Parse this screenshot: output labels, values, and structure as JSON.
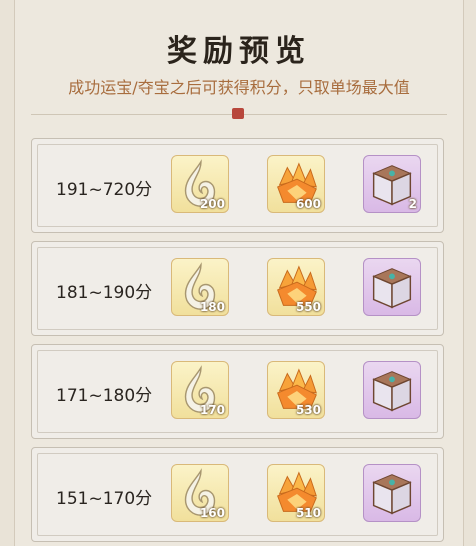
{
  "title": "奖励预览",
  "subtitle": "成功运宝/夺宝之后可获得积分，只取单场最大值",
  "rows": [
    {
      "range": "191~720分",
      "jade": "200",
      "crystal": "600",
      "chest": "2"
    },
    {
      "range": "181~190分",
      "jade": "180",
      "crystal": "550",
      "chest": ""
    },
    {
      "range": "171~180分",
      "jade": "170",
      "crystal": "530",
      "chest": ""
    },
    {
      "range": "151~170分",
      "jade": "160",
      "crystal": "510",
      "chest": ""
    }
  ]
}
